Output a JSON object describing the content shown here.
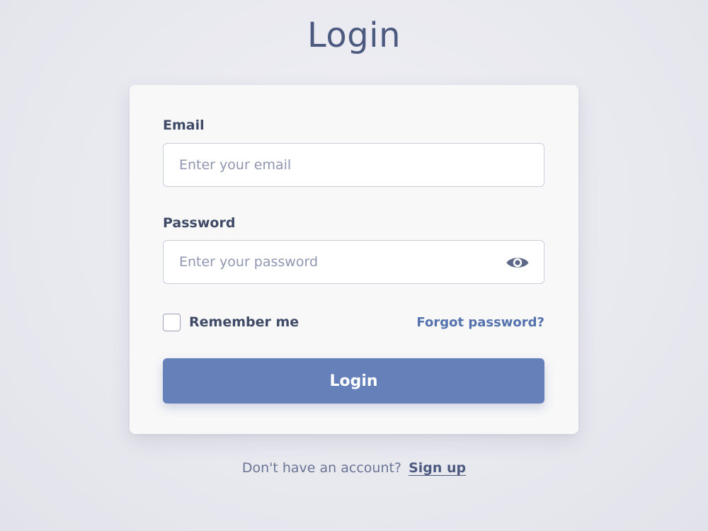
{
  "page": {
    "title": "Login"
  },
  "form": {
    "email": {
      "label": "Email",
      "value": "",
      "placeholder": "Enter your email"
    },
    "password": {
      "label": "Password",
      "value": "",
      "placeholder": "Enter your password",
      "toggle_icon": "eye-icon"
    },
    "remember": {
      "label": "Remember me",
      "checked": false
    },
    "forgot_link": "Forgot password?",
    "submit_label": "Login"
  },
  "footer": {
    "prompt": "Don't have an account?",
    "signup_link": "Sign up"
  },
  "colors": {
    "accent": "#6681b9",
    "link": "#5472ad",
    "title": "#4d5a80",
    "background": "#ececf2",
    "card": "#f8f8f9"
  }
}
